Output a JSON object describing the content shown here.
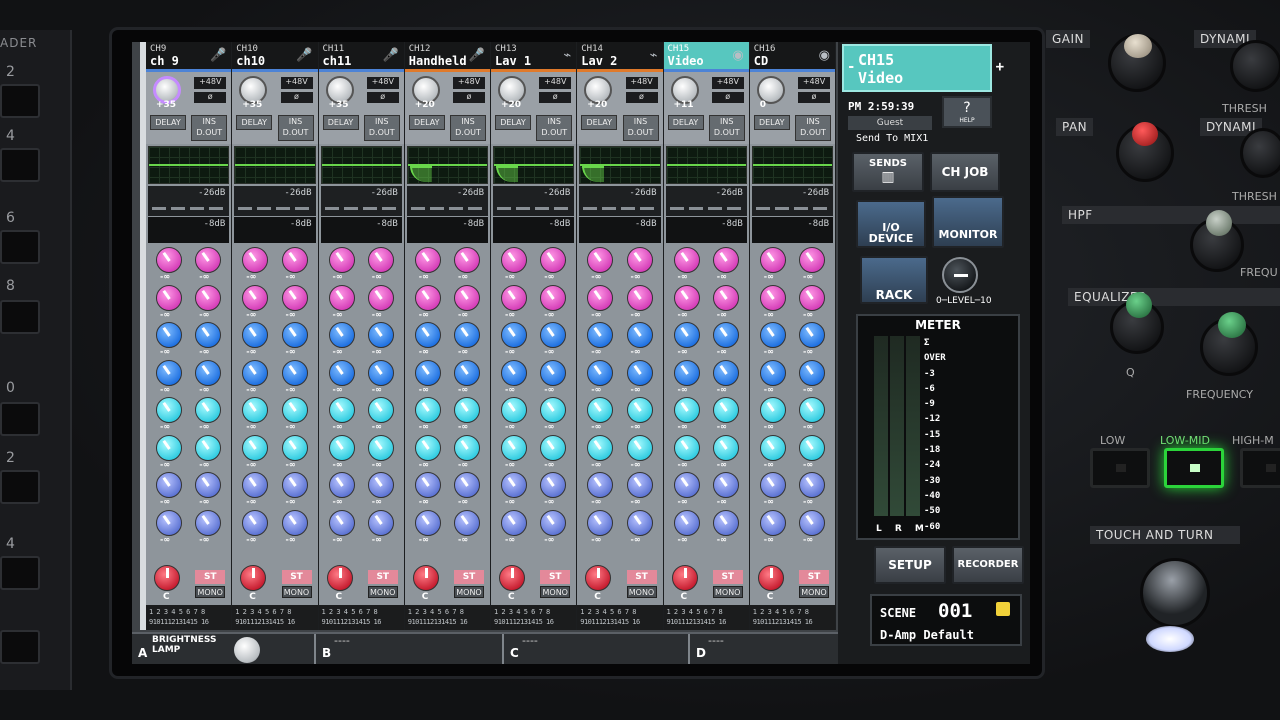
{
  "left_panel": {
    "header": "ADER",
    "numbers": [
      "2",
      "4",
      "6",
      "8",
      "0",
      "2",
      "4"
    ]
  },
  "channels": [
    {
      "num": "CH9",
      "name": "ch 9",
      "icon": "microphone-icon",
      "gain": "+35",
      "color": "blue"
    },
    {
      "num": "CH10",
      "name": "ch10",
      "icon": "microphone-icon",
      "gain": "+35",
      "color": "blue"
    },
    {
      "num": "CH11",
      "name": "ch11",
      "icon": "microphone-icon",
      "gain": "+35",
      "color": "blue"
    },
    {
      "num": "CH12",
      "name": "Handheld",
      "icon": "microphone-icon",
      "gain": "+20",
      "color": "orange"
    },
    {
      "num": "CH13",
      "name": "Lav 1",
      "icon": "lavalier-icon",
      "gain": "+20",
      "color": "orange"
    },
    {
      "num": "CH14",
      "name": "Lav 2",
      "icon": "lavalier-icon",
      "gain": "+20",
      "color": "orange"
    },
    {
      "num": "CH15",
      "name": "Video",
      "icon": "disc-icon",
      "gain": "+11",
      "color": "cyan"
    },
    {
      "num": "CH16",
      "name": "CD",
      "icon": "disc-icon",
      "gain": "0",
      "color": "blue"
    }
  ],
  "strip_labels": {
    "plus48": "+48V",
    "phase": "ø",
    "delay": "DELAY",
    "ins1": "INS",
    "ins2": "D.OUT",
    "thresh1": "-26dB",
    "thresh2": "-8dB",
    "send_value": "-∞",
    "pan": "C",
    "st": "ST",
    "mono": "MONO",
    "assign_top": "1 2 3 4 5 6 7 8",
    "assign_bottom": "9101112131415 16"
  },
  "bottom_bar": {
    "a_label": "A",
    "brightness": "BRIGHTNESS",
    "lamp": "LAMP",
    "b_label": "B",
    "c_label": "C",
    "d_label": "D",
    "placeholder": "----"
  },
  "right_panel": {
    "selected_channel_num": "CH15",
    "selected_channel_name": "Video",
    "arrow_left": "-",
    "arrow_right": "+",
    "time": "PM 2:59:39",
    "user": "Guest",
    "help_icon": "?",
    "help": "HELP",
    "send_to": "Send To MIX1",
    "sends_on_fader": "SENDS",
    "ch_job": "CH JOB",
    "io_device": "I/O DEVICE",
    "monitor": "MONITOR",
    "rack": "RACK",
    "level": "0─LEVEL─10",
    "meter_title": "METER",
    "meter_scale": [
      "Σ",
      "OVER",
      "-3",
      "-6",
      "-9",
      "-12",
      "-15",
      "-18",
      "-24",
      "-30",
      "-40",
      "-50",
      "-60"
    ],
    "meter_lrm": "L R M",
    "setup": "SETUP",
    "recorder": "RECORDER",
    "scene_label": "SCENE",
    "scene_number": "001",
    "scene_name": "D-Amp Default"
  },
  "hardware": {
    "gain": "GAIN",
    "dynamics": "DYNAMI",
    "pan": "PAN",
    "threshold": "THRESH",
    "hpf": "HPF",
    "frequency": "FREQU",
    "equalizer": "EQUALIZER",
    "q": "Q",
    "eq_frequency": "FREQUENCY",
    "low": "LOW",
    "low_mid": "LOW-MID",
    "high_mid": "HIGH-M",
    "touch_and_turn": "TOUCH AND TURN"
  }
}
